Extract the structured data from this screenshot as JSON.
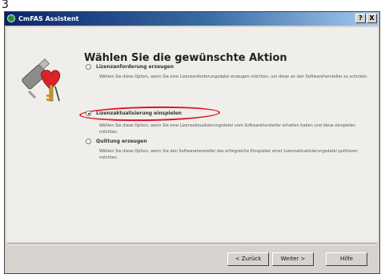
{
  "page_number": "3",
  "window": {
    "title": "CmFAS Assistent",
    "help_button": "?",
    "close_button": "X"
  },
  "main": {
    "heading": "Wählen Sie die gewünschte Aktion",
    "options": [
      {
        "label": "Lizenzanforderung erzeugen",
        "description": "Wählen Sie diese Option, wenn Sie eine Lizenzanforderungsdatei erzeugen möchten, um diese an den Softwarehersteller zu schicken.",
        "selected": false
      },
      {
        "label": "Lizenzaktualisierung einspielen",
        "description": "Wählen Sie diese Option, wenn Sie eine Lizenzaktualisierungsdatei vom Softwarehersteller erhalten haben und diese einspielen möchten.",
        "selected": true
      },
      {
        "label": "Quittung erzeugen",
        "description": "Wählen Sie diese Option, wenn Sie den Softwarehersteller das erfolgreiche Einspielen einer Lizenzaktualisierungsdatei quittieren möchten.",
        "selected": false
      }
    ]
  },
  "footer": {
    "back_label": "< Zurück",
    "next_label": "Weiter >",
    "help_label": "Hilfe"
  },
  "colors": {
    "titlebar_start": "#0a246a",
    "titlebar_end": "#a6caf0",
    "highlight": "#e0141e",
    "dialog_face": "#d6d3ce"
  },
  "icons": [
    "cmfas-app-icon",
    "usb-dongle-key-icon"
  ]
}
